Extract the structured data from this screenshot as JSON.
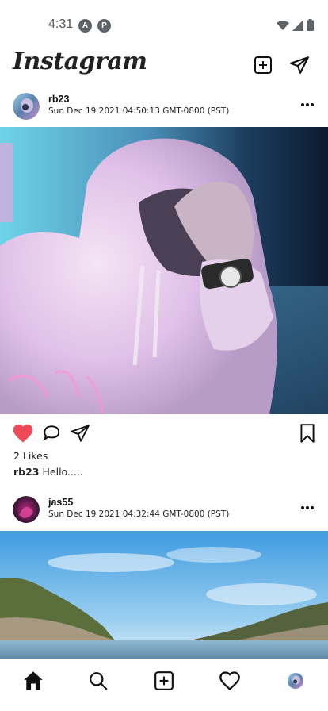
{
  "status_bar": {
    "time": "4:31",
    "badge_1": "A",
    "badge_2": "P",
    "icons": [
      "wifi-icon",
      "cell-signal-icon",
      "battery-icon"
    ]
  },
  "header": {
    "logo": "Instagram",
    "add_post_icon": "plus-square-icon",
    "direct_icon": "paper-plane-icon"
  },
  "posts": [
    {
      "username": "rb23",
      "date": "Sun Dec 19 2021 04:50:13 GMT-0800 (PST)",
      "likes": "2 Likes",
      "caption_user": "rb23",
      "caption_text": "Hello.....",
      "liked": true
    },
    {
      "username": "jas55",
      "date": "Sun Dec 19 2021 04:32:44 GMT-0800 (PST)"
    }
  ],
  "bottom_nav": [
    "home-icon",
    "search-icon",
    "add-icon",
    "heart-icon",
    "profile-avatar"
  ],
  "colors": {
    "like_red": "#ed4956",
    "text": "#111111"
  }
}
